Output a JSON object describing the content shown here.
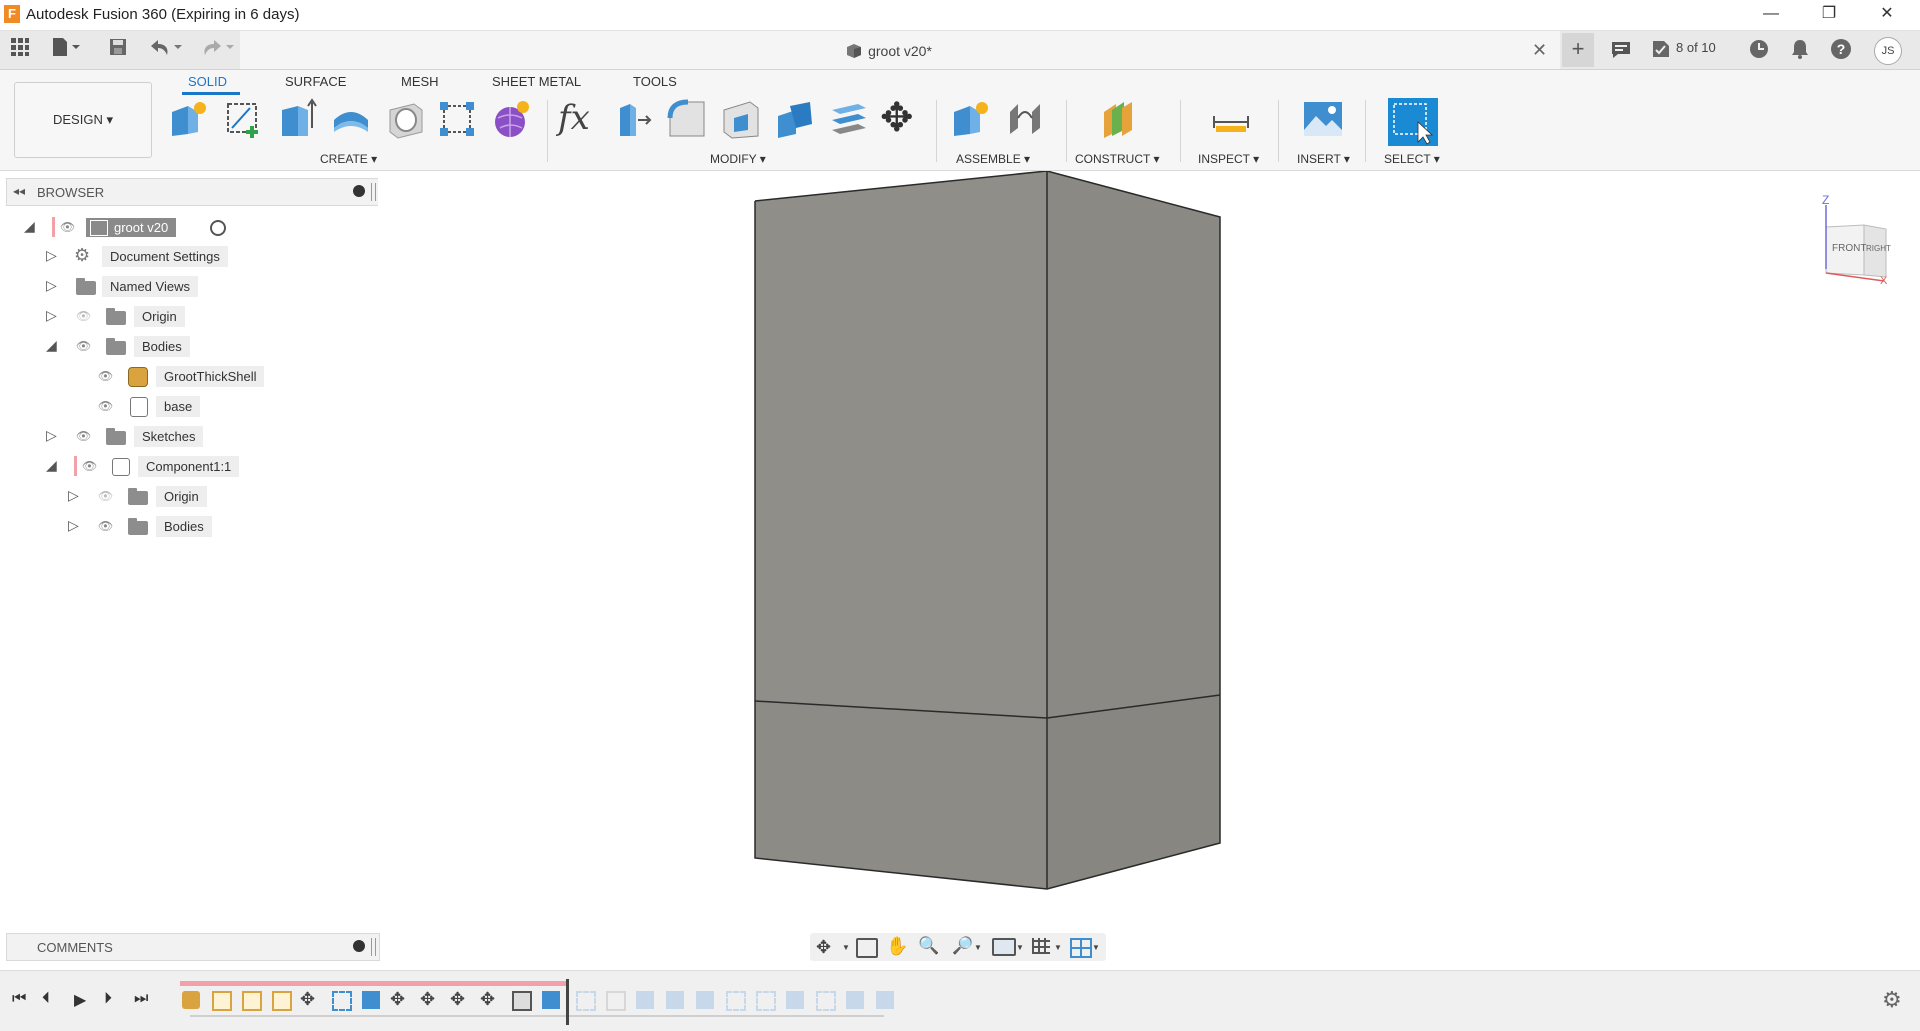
{
  "window": {
    "title": "Autodesk Fusion 360 (Expiring in 6 days)",
    "logo_letter": "F",
    "minimize": "—",
    "restore": "❐",
    "close": "✕"
  },
  "document": {
    "tab_title": "groot v20*",
    "close_glyph": "✕",
    "plus_glyph": "+",
    "job_status": "8 of 10",
    "user_initials": "JS"
  },
  "toolbar": {
    "workspace": "DESIGN ▾",
    "tabs": [
      "SOLID",
      "SURFACE",
      "MESH",
      "SHEET METAL",
      "TOOLS"
    ],
    "groups": {
      "create": "CREATE ▾",
      "modify": "MODIFY ▾",
      "assemble": "ASSEMBLE ▾",
      "construct": "CONSTRUCT ▾",
      "inspect": "INSPECT ▾",
      "insert": "INSERT ▾",
      "select": "SELECT ▾"
    },
    "fx_label": "fx",
    "move_glyph": "✥"
  },
  "browser": {
    "title": "BROWSER",
    "items": [
      {
        "label": "groot v20"
      },
      {
        "label": "Document Settings"
      },
      {
        "label": "Named Views"
      },
      {
        "label": "Origin"
      },
      {
        "label": "Bodies"
      },
      {
        "label": "GrootThickShell"
      },
      {
        "label": "base"
      },
      {
        "label": "Sketches"
      },
      {
        "label": "Component1:1"
      },
      {
        "label": "Origin"
      },
      {
        "label": "Bodies"
      }
    ]
  },
  "viewcube": {
    "front": "FRONT",
    "right": "RIGHT",
    "z_axis": "Z",
    "x_axis": "X"
  },
  "comments": {
    "title": "COMMENTS"
  },
  "colors": {
    "accent": "#1a76c7",
    "body_front": "#8f8e88",
    "body_side": "#878680",
    "timeline_marker": "#f4a0a8"
  }
}
